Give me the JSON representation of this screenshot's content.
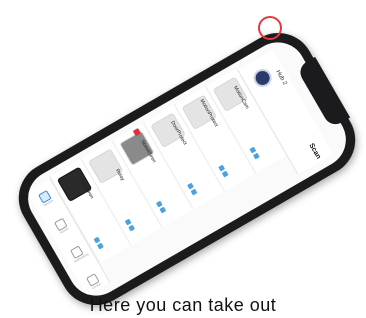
{
  "header": {
    "hub_title": "Hub 2",
    "scan_label": "Scan"
  },
  "devices": [
    {
      "name": "MotionCam"
    },
    {
      "name": "MotionProtect"
    },
    {
      "name": "DoorProtect"
    },
    {
      "name": "StreetSiren"
    },
    {
      "name": "Relay"
    },
    {
      "name": "StreetSiren"
    }
  ],
  "tabs": [
    {
      "label": "Devices"
    },
    {
      "label": "Rooms"
    },
    {
      "label": "Notifications"
    },
    {
      "label": "Control"
    }
  ],
  "caption": "Here you can take out"
}
